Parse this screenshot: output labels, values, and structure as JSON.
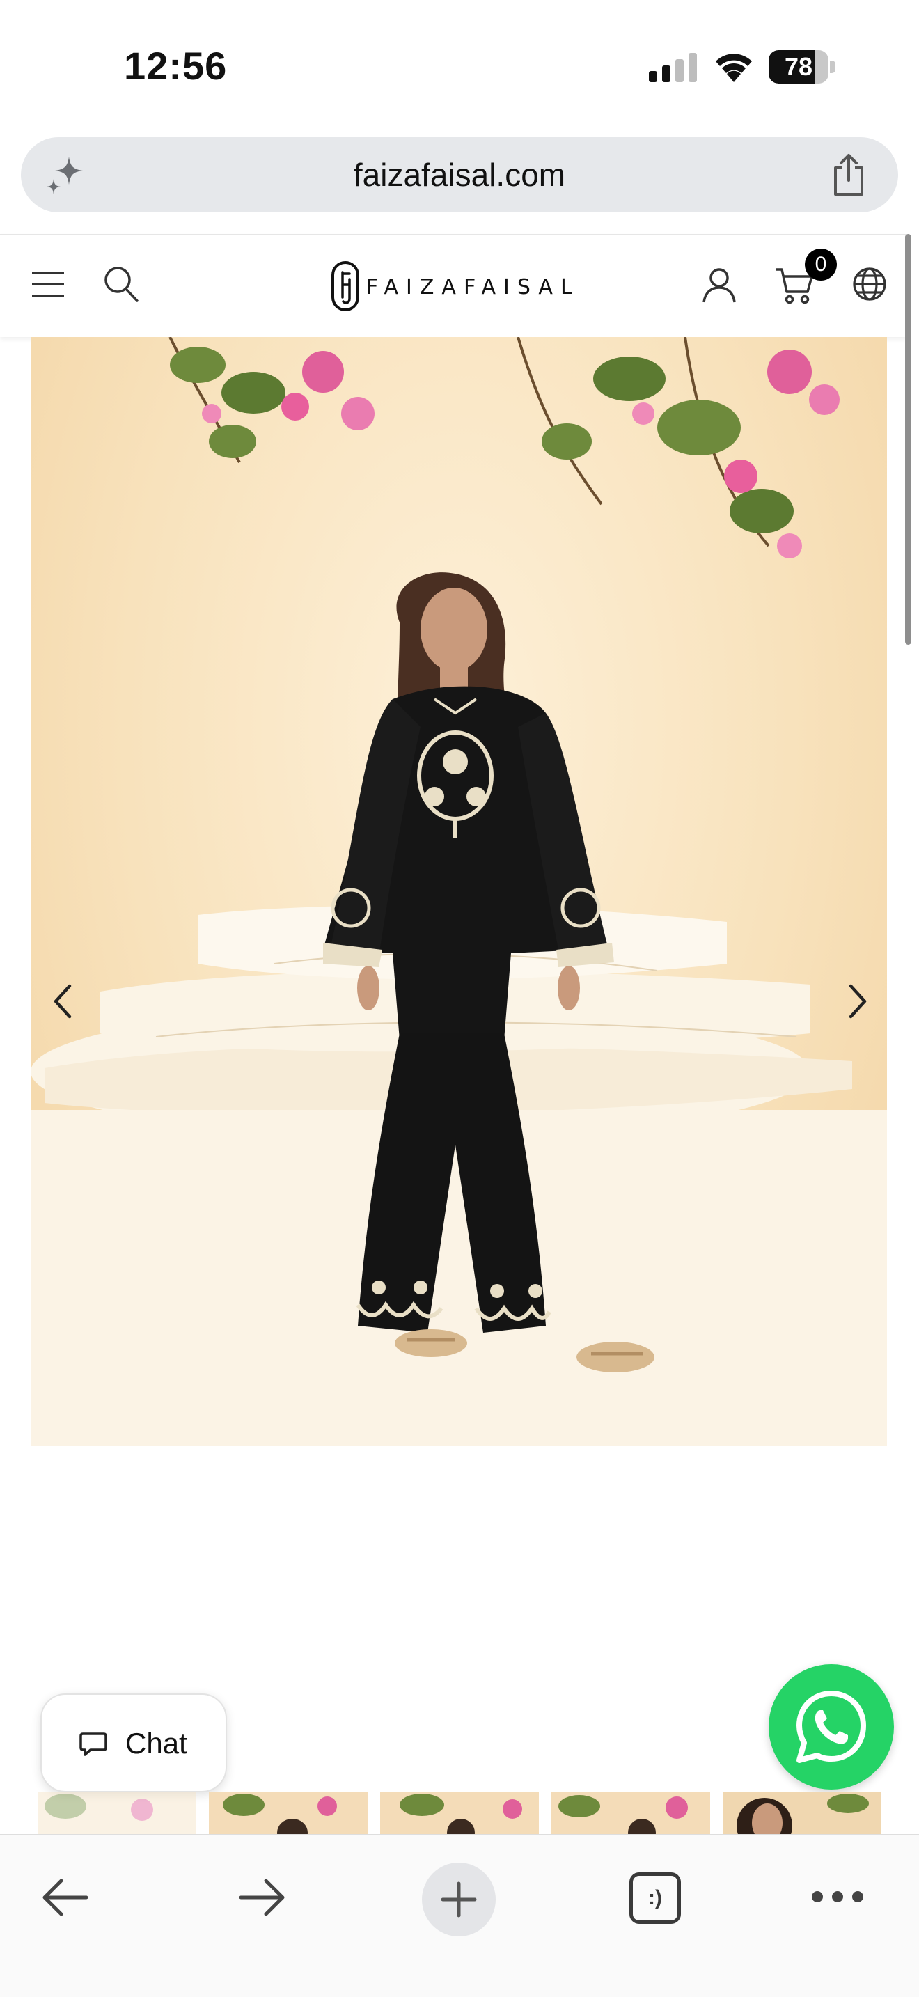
{
  "status_bar": {
    "time": "12:56",
    "battery": "78",
    "battery_level": 0.78
  },
  "browser": {
    "url": "faizafaisal.com",
    "tabs_label": ":)"
  },
  "header": {
    "brand": "FAIZAFAISAL",
    "cart_count": "0"
  },
  "chat": {
    "label": "Chat"
  },
  "icons": [
    "sparkle-icon",
    "share-icon",
    "menu-icon",
    "search-icon",
    "account-icon",
    "cart-icon",
    "globe-icon",
    "chevron-left-icon",
    "chevron-right-icon",
    "chat-icon",
    "whatsapp-icon",
    "back-arrow-icon",
    "forward-arrow-icon",
    "plus-icon",
    "more-icon"
  ],
  "colors": {
    "whatsapp": "#25d366",
    "url_bar": "#e6e8eb",
    "image_background": "#f8e2bc",
    "garment": "#151515",
    "embroidery": "#e9dfc6"
  },
  "thumbnails_count": 5
}
